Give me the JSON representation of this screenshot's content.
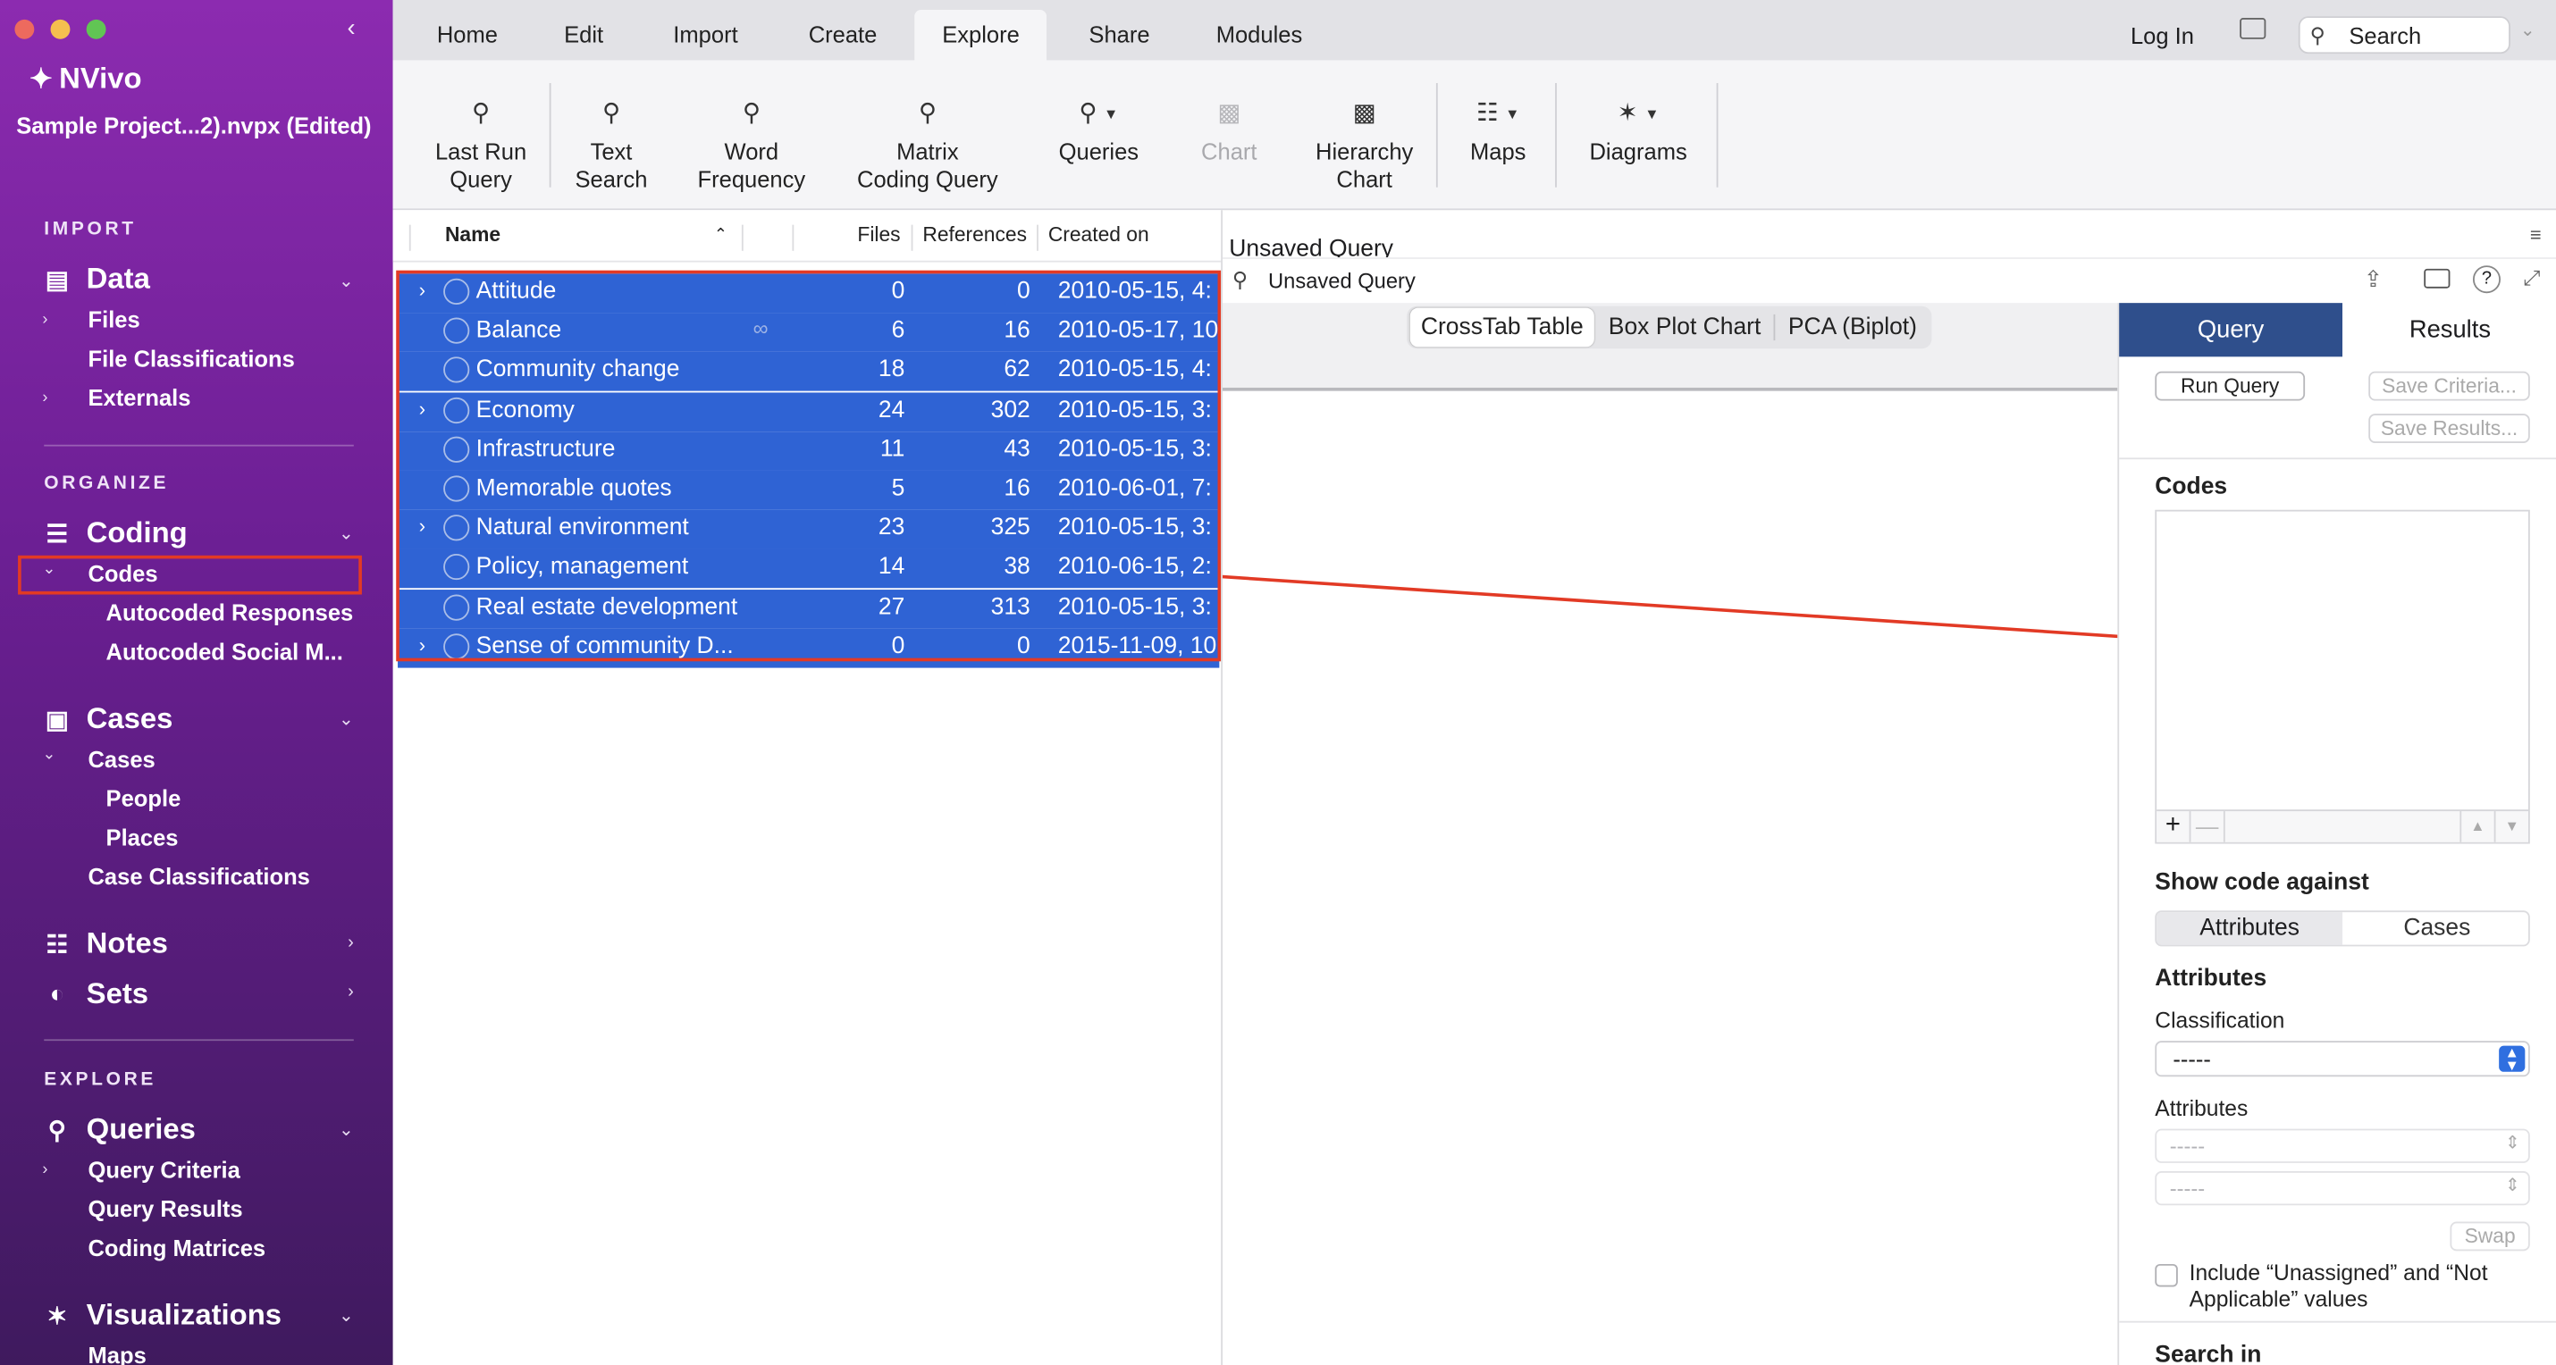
{
  "window": {
    "app_name": "NVivo",
    "project_title": "Sample Project...2).nvpx (Edited)"
  },
  "sidebar": {
    "sections": {
      "import": "IMPORT",
      "organize": "ORGANIZE",
      "explore": "EXPLORE"
    },
    "data": {
      "label": "Data",
      "items": [
        "Files",
        "File Classifications",
        "Externals"
      ]
    },
    "coding": {
      "label": "Coding",
      "codes": "Codes",
      "sub": [
        "Autocoded Responses",
        "Autocoded Social M..."
      ]
    },
    "cases": {
      "label": "Cases",
      "cases": "Cases",
      "sub": [
        "People",
        "Places"
      ],
      "classifications": "Case Classifications"
    },
    "notes": {
      "label": "Notes"
    },
    "sets": {
      "label": "Sets"
    },
    "queries": {
      "label": "Queries",
      "items": [
        "Query Criteria",
        "Query Results",
        "Coding Matrices"
      ]
    },
    "visualizations": {
      "label": "Visualizations",
      "items": [
        "Maps"
      ]
    }
  },
  "menu_tabs": [
    "Home",
    "Edit",
    "Import",
    "Create",
    "Explore",
    "Share",
    "Modules"
  ],
  "active_tab": "Explore",
  "top_right": {
    "login": "Log In",
    "search_placeholder": "Search"
  },
  "ribbon": {
    "last_run_query": [
      "Last Run",
      "Query"
    ],
    "text_search": [
      "Text",
      "Search"
    ],
    "word_frequency": [
      "Word",
      "Frequency"
    ],
    "matrix_coding_query": [
      "Matrix",
      "Coding Query"
    ],
    "queries": "Queries",
    "chart": "Chart",
    "hierarchy_chart": [
      "Hierarchy",
      "Chart"
    ],
    "maps": "Maps",
    "diagrams": "Diagrams"
  },
  "code_list": {
    "columns": {
      "name": "Name",
      "files": "Files",
      "references": "References",
      "created_on": "Created on"
    },
    "rows": [
      {
        "name": "Attitude",
        "files": "0",
        "refs": "0",
        "created": "2010-05-15, 4:",
        "expandable": true
      },
      {
        "name": "Balance",
        "files": "6",
        "refs": "16",
        "created": "2010-05-17, 10",
        "expandable": false
      },
      {
        "name": "Community change",
        "files": "18",
        "refs": "62",
        "created": "2010-05-15, 4:",
        "expandable": false
      },
      {
        "name": "Economy",
        "files": "24",
        "refs": "302",
        "created": "2010-05-15, 3:",
        "expandable": true
      },
      {
        "name": "Infrastructure",
        "files": "11",
        "refs": "43",
        "created": "2010-05-15, 3:",
        "expandable": false
      },
      {
        "name": "Memorable quotes",
        "files": "5",
        "refs": "16",
        "created": "2010-06-01, 7:",
        "expandable": false
      },
      {
        "name": "Natural environment",
        "files": "23",
        "refs": "325",
        "created": "2010-05-15, 3:",
        "expandable": true
      },
      {
        "name": "Policy, management",
        "files": "14",
        "refs": "38",
        "created": "2010-06-15, 2:",
        "expandable": false
      },
      {
        "name": "Real estate development",
        "files": "27",
        "refs": "313",
        "created": "2010-05-15, 3:",
        "expandable": false
      },
      {
        "name": "Sense of community D...",
        "files": "0",
        "refs": "0",
        "created": "2015-11-09, 10",
        "expandable": true
      }
    ]
  },
  "detail": {
    "title": "Unsaved Query",
    "subtitle": "Unsaved Query",
    "view_tabs": [
      "CrossTab Table",
      "Box Plot Chart",
      "PCA (Biplot)"
    ],
    "active_view": "CrossTab Table"
  },
  "query_panel": {
    "tabs": [
      "Query",
      "Results"
    ],
    "run_query": "Run Query",
    "save_criteria": "Save Criteria...",
    "save_results": "Save Results...",
    "codes_label": "Codes",
    "show_code_against": "Show code against",
    "segments": [
      "Attributes",
      "Cases"
    ],
    "attributes_heading": "Attributes",
    "classification_label": "Classification",
    "classification_value": "-----",
    "attributes_label": "Attributes",
    "attribute_values": [
      "-----",
      "-----"
    ],
    "swap": "Swap",
    "include_text": [
      "Include “Unassigned” and “Not",
      "Applicable” values"
    ],
    "search_in": "Search in"
  },
  "colors": {
    "accent": "#2f63d4",
    "sidebar_top": "#8c2bb0",
    "annotation": "#e23a25",
    "query_tab": "#2f4f8c"
  }
}
